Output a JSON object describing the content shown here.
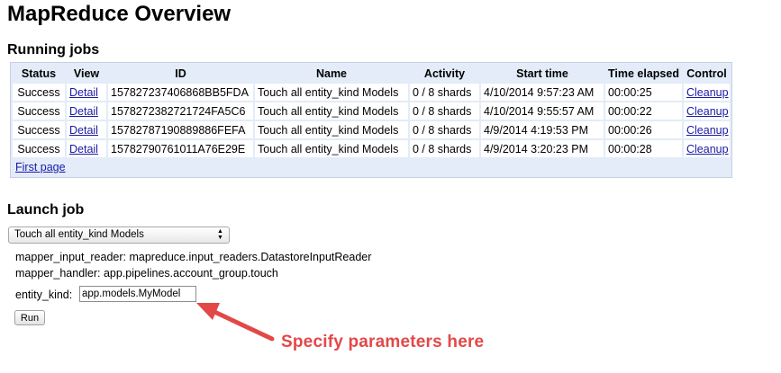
{
  "page_title": "MapReduce Overview",
  "running_jobs": {
    "title": "Running jobs",
    "headers": [
      "Status",
      "View",
      "ID",
      "Name",
      "Activity",
      "Start time",
      "Time elapsed",
      "Control"
    ],
    "rows": [
      {
        "status": "Success",
        "view": "Detail",
        "id": "157827237406868BB5FDA",
        "name": "Touch all entity_kind Models",
        "activity": "0 / 8 shards",
        "start_time": "4/10/2014 9:57:23 AM",
        "elapsed": "00:00:25",
        "control": "Cleanup"
      },
      {
        "status": "Success",
        "view": "Detail",
        "id": "157827238272172​4FA5C6",
        "name": "Touch all entity_kind Models",
        "activity": "0 / 8 shards",
        "start_time": "4/10/2014 9:55:57 AM",
        "elapsed": "00:00:22",
        "control": "Cleanup"
      },
      {
        "status": "Success",
        "view": "Detail",
        "id": "15782787190889886FEFA",
        "name": "Touch all entity_kind Models",
        "activity": "0 / 8 shards",
        "start_time": "4/9/2014 4:19:53 PM",
        "elapsed": "00:00:26",
        "control": "Cleanup"
      },
      {
        "status": "Success",
        "view": "Detail",
        "id": "15782790761011A76E29E",
        "name": "Touch all entity_kind Models",
        "activity": "0 / 8 shards",
        "start_time": "4/9/2014 3:20:23 PM",
        "elapsed": "00:00:28",
        "control": "Cleanup"
      }
    ],
    "first_page_label": "First page"
  },
  "launch_job": {
    "title": "Launch job",
    "selected_job": "Touch all entity_kind Models",
    "mapper_input_reader": "mapper_input_reader: mapreduce.input_readers.DatastoreInputReader",
    "mapper_handler": "mapper_handler: app.pipelines.account_group.touch",
    "entity_kind_label": "entity_kind:",
    "entity_kind_value": "app.models.MyModel",
    "run_label": "Run"
  },
  "annotation": {
    "text": "Specify parameters here",
    "color": "#e34848"
  },
  "colors": {
    "table_background": "#e3ecf8",
    "link": "#1a1aa6"
  }
}
